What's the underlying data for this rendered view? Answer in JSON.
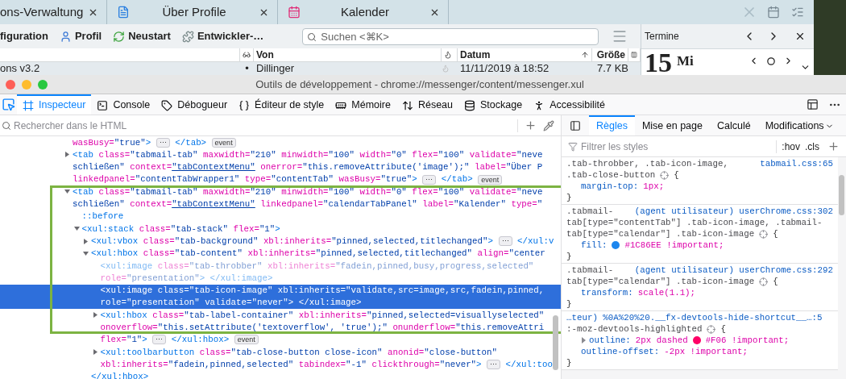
{
  "mail_app": {
    "tabs": [
      {
        "label": "ons-Verwaltung"
      },
      {
        "label": "Über Profile"
      },
      {
        "label": "Kalender"
      }
    ],
    "toolbar": [
      {
        "label": "figuration"
      },
      {
        "label": "Profil"
      },
      {
        "label": "Neustart"
      },
      {
        "label": "Entwickler-…"
      }
    ],
    "search": {
      "placeholder": "Suchen <⌘K>"
    },
    "columns": [
      {
        "kind": "text"
      },
      {
        "kind": "icon"
      },
      {
        "kind": "text",
        "label": "Von"
      },
      {
        "kind": "icon"
      },
      {
        "kind": "sort",
        "label": "Datum"
      },
      {
        "kind": "text",
        "label": "Größe"
      },
      {
        "kind": "icon"
      }
    ],
    "row": {
      "subject": "ons v3.2",
      "read_mark": "•",
      "from": "Dillinger",
      "date": "11/11/2019 à 18:52",
      "size": "7.7 KB"
    },
    "today_pane": {
      "title": "Termine",
      "day": "15",
      "weekday": "Mi"
    }
  },
  "devtools": {
    "title": "Outils de développement - chrome://messenger/content/messenger.xul",
    "tools": [
      {
        "label": "Inspecteur",
        "selected": true
      },
      {
        "label": "Console",
        "selected": false
      },
      {
        "label": "Débogueur",
        "selected": false
      },
      {
        "label": "Éditeur de style",
        "selected": false
      },
      {
        "label": "Mémoire",
        "selected": false
      },
      {
        "label": "Réseau",
        "selected": false
      },
      {
        "label": "Stockage",
        "selected": false
      },
      {
        "label": "Accessibilité",
        "selected": false
      }
    ],
    "html_search": {
      "placeholder": "Rechercher dans le HTML"
    },
    "markup": {
      "nodes": [
        {
          "kind": "leaf",
          "selected": false,
          "dimmed": false,
          "lines": [
            [
              {
                "kind": "attr",
                "name": "wasBusy=",
                "value": "\"true\"",
                "end": ">"
              },
              {
                "kind": "badge",
                "text": "⋯"
              },
              {
                "kind": "tag",
                "text": "</tab>"
              },
              {
                "kind": "badge",
                "text": "event"
              }
            ]
          ]
        },
        {
          "kind": "collapsed",
          "selected": false,
          "dimmed": false,
          "lines": [
            [
              {
                "kind": "tag",
                "text": "<tab"
              },
              {
                "kind": "attr",
                "name": "class=",
                "value": "\"tabmail-tab\""
              },
              {
                "kind": "attr",
                "name": "maxwidth=",
                "value": "\"210\""
              },
              {
                "kind": "attr",
                "name": "minwidth=",
                "value": "\"100\""
              },
              {
                "kind": "attr",
                "name": "width=",
                "value": "\"0\""
              },
              {
                "kind": "attr",
                "name": "flex=",
                "value": "\"100\""
              },
              {
                "kind": "attr",
                "name": "validate=",
                "value": "\"neve"
              }
            ],
            [
              {
                "kind": "attr",
                "value": "schließen\""
              },
              {
                "kind": "attr",
                "name": "context=",
                "value": "\"tabContextMenu\"",
                "link": true
              },
              {
                "kind": "attr",
                "name": "onerror=",
                "value": "\"this.removeAttribute('image');\""
              },
              {
                "kind": "attr",
                "name": "label=",
                "value": "\"Über P"
              }
            ],
            [
              {
                "kind": "attr",
                "name": "linkedpanel=",
                "value": "\"contentTabWrapper1\""
              },
              {
                "kind": "attr",
                "name": "type=",
                "value": "\"contentTab\""
              },
              {
                "kind": "attr",
                "name": "wasBusy=",
                "value": "\"true\"",
                "end": ">"
              },
              {
                "kind": "badge",
                "text": "⋯"
              },
              {
                "kind": "tag",
                "text": "</tab>"
              },
              {
                "kind": "badge",
                "text": "event"
              }
            ]
          ]
        },
        {
          "kind": "expanded",
          "selected": false,
          "dimmed": false,
          "lines": [
            [
              {
                "kind": "tag",
                "text": "<tab"
              },
              {
                "kind": "attr",
                "name": "class=",
                "value": "\"tabmail-tab\""
              },
              {
                "kind": "attr",
                "name": "maxwidth=",
                "value": "\"210\""
              },
              {
                "kind": "attr",
                "name": "minwidth=",
                "value": "\"100\""
              },
              {
                "kind": "attr",
                "name": "width=",
                "value": "\"0\""
              },
              {
                "kind": "attr",
                "name": "flex=",
                "value": "\"100\""
              },
              {
                "kind": "attr",
                "name": "validate=",
                "value": "\"neve"
              }
            ],
            [
              {
                "kind": "attr",
                "value": "schließen\""
              },
              {
                "kind": "attr",
                "name": "context=",
                "value": "\"tabContextMenu\"",
                "link": true
              },
              {
                "kind": "attr",
                "name": "linkedpanel=",
                "value": "\"calendarTabPanel\""
              },
              {
                "kind": "attr",
                "name": "label=",
                "value": "\"Kalender\""
              },
              {
                "kind": "attr",
                "name": "type=",
                "value": "\""
              }
            ]
          ],
          "children": [
            {
              "kind": "leaf",
              "selected": false,
              "dimmed": false,
              "lines": [
                [
                  {
                    "kind": "tag",
                    "text": "::before"
                  }
                ]
              ]
            },
            {
              "kind": "expanded",
              "selected": false,
              "dimmed": false,
              "lines": [
                [
                  {
                    "kind": "tag",
                    "text": "<xul:stack"
                  },
                  {
                    "kind": "attr",
                    "name": "class=",
                    "value": "\"tab-stack\""
                  },
                  {
                    "kind": "attr",
                    "name": "flex=",
                    "value": "\"1\"",
                    "end": ">"
                  }
                ]
              ],
              "children": [
                {
                  "kind": "collapsed",
                  "selected": false,
                  "dimmed": false,
                  "lines": [
                    [
                      {
                        "kind": "tag",
                        "text": "<xul:vbox"
                      },
                      {
                        "kind": "attr",
                        "name": "class=",
                        "value": "\"tab-background\""
                      },
                      {
                        "kind": "attr",
                        "name": "xbl:inherits=",
                        "value": "\"pinned,selected,titlechanged\"",
                        "end": ">"
                      },
                      {
                        "kind": "badge",
                        "text": "⋯"
                      },
                      {
                        "kind": "tag",
                        "text": "</xul:v"
                      }
                    ]
                  ]
                },
                {
                  "kind": "expanded",
                  "selected": false,
                  "dimmed": false,
                  "lines": [
                    [
                      {
                        "kind": "tag",
                        "text": "<xul:hbox"
                      },
                      {
                        "kind": "attr",
                        "name": "class=",
                        "value": "\"tab-content\""
                      },
                      {
                        "kind": "attr",
                        "name": "xbl:inherits=",
                        "value": "\"pinned,selected,titlechanged\""
                      },
                      {
                        "kind": "attr",
                        "name": "align=",
                        "value": "\"center"
                      }
                    ]
                  ],
                  "children": [
                    {
                      "kind": "leaf",
                      "selected": false,
                      "dimmed": true,
                      "lines": [
                        [
                          {
                            "kind": "tag",
                            "text": "<xul:image"
                          },
                          {
                            "kind": "attr",
                            "name": "class=",
                            "value": "\"tab-throbber\""
                          },
                          {
                            "kind": "attr",
                            "name": "xbl:inherits=",
                            "value": "\"fadein,pinned,busy,progress,selected\""
                          }
                        ],
                        [
                          {
                            "kind": "attr",
                            "name": "role=",
                            "value": "\"presentation\"",
                            "end": ">"
                          },
                          {
                            "kind": "tag",
                            "text": "</xul:image>"
                          }
                        ]
                      ]
                    },
                    {
                      "kind": "leaf",
                      "selected": true,
                      "dimmed": false,
                      "lines": [
                        [
                          {
                            "kind": "tag",
                            "text": "<xul:image"
                          },
                          {
                            "kind": "attr",
                            "name": "class=",
                            "value": "\"tab-icon-image\""
                          },
                          {
                            "kind": "attr",
                            "name": "xbl:inherits=",
                            "value": "\"validate,src=image,src,fadein,pinned,"
                          }
                        ],
                        [
                          {
                            "kind": "attr",
                            "name": "role=",
                            "value": "\"presentation\""
                          },
                          {
                            "kind": "attr",
                            "name": "validate=",
                            "value": "\"never\"",
                            "end": ">"
                          },
                          {
                            "kind": "tag",
                            "text": "</xul:image>"
                          }
                        ]
                      ]
                    },
                    {
                      "kind": "collapsed",
                      "selected": false,
                      "dimmed": false,
                      "lines": [
                        [
                          {
                            "kind": "tag",
                            "text": "<xul:hbox"
                          },
                          {
                            "kind": "attr",
                            "name": "class=",
                            "value": "\"tab-label-container\""
                          },
                          {
                            "kind": "attr",
                            "name": "xbl:inherits=",
                            "value": "\"pinned,selected=visuallyselected\""
                          }
                        ],
                        [
                          {
                            "kind": "attr",
                            "name": "onoverflow=",
                            "value": "\"this.setAttribute('textoverflow', 'true');\""
                          },
                          {
                            "kind": "attr",
                            "name": "onunderflow=",
                            "value": "\"this.removeAttri"
                          }
                        ],
                        [
                          {
                            "kind": "attr",
                            "name": "flex=",
                            "value": "\"1\"",
                            "end": ">"
                          },
                          {
                            "kind": "badge",
                            "text": "⋯"
                          },
                          {
                            "kind": "tag",
                            "text": "</xul:hbox>"
                          },
                          {
                            "kind": "badge",
                            "text": "event"
                          }
                        ]
                      ]
                    },
                    {
                      "kind": "collapsed",
                      "selected": false,
                      "dimmed": false,
                      "lines": [
                        [
                          {
                            "kind": "tag",
                            "text": "<xul:toolbarbutton"
                          },
                          {
                            "kind": "attr",
                            "name": "class=",
                            "value": "\"tab-close-button close-icon\""
                          },
                          {
                            "kind": "attr",
                            "name": "anonid=",
                            "value": "\"close-button\""
                          }
                        ],
                        [
                          {
                            "kind": "attr",
                            "name": "xbl:inherits=",
                            "value": "\"fadein,pinned,selected\""
                          },
                          {
                            "kind": "attr",
                            "name": "tabindex=",
                            "value": "\"-1\""
                          },
                          {
                            "kind": "attr",
                            "name": "clickthrough=",
                            "value": "\"never\"",
                            "end": ">"
                          },
                          {
                            "kind": "badge",
                            "text": "⋯"
                          },
                          {
                            "kind": "tag",
                            "text": "</xul:too"
                          }
                        ]
                      ]
                    }
                  ],
                  "close": [
                    {
                      "kind": "tag",
                      "text": "</xul:hbox>"
                    }
                  ]
                }
              ]
            }
          ]
        }
      ]
    },
    "sidebar_tabs": [
      {
        "label": "Règles",
        "selected": true
      },
      {
        "label": "Mise en page",
        "selected": false
      },
      {
        "label": "Calculé",
        "selected": false
      },
      {
        "label": "Modifications",
        "selected": false
      }
    ],
    "rules_filter": {
      "placeholder": "Filtrer les styles",
      "buttons": [
        ":hov",
        ".cls"
      ]
    },
    "rules": [
      {
        "source": "tabmail.css:65",
        "source_own_line": false,
        "selector_lines": [
          ".tab-throbber, .tab-icon-image,",
          ".tab-close-button"
        ],
        "open": "{",
        "close": "}",
        "declarations": [
          {
            "property": "margin-top:",
            "expandable": false,
            "value": [
              "1px;"
            ]
          }
        ]
      },
      {
        "source": "(agent utilisateur) userChrome.css:302",
        "source_own_line": false,
        "selector_lines": [
          ".tabmail-",
          "tab[type=\"contentTab\"] .tab-icon-image, .tabmail-",
          "tab[type=\"calendar\"] .tab-icon-image"
        ],
        "open": "{",
        "close": "}",
        "declarations": [
          {
            "property": "fill:",
            "expandable": false,
            "color": "#1C86EE",
            "value": [
              "#1C86EE !important;"
            ]
          }
        ]
      },
      {
        "source": "(agent utilisateur) userChrome.css:292",
        "source_own_line": false,
        "selector_lines": [
          ".tabmail-",
          "tab[type=\"calendar\"] .tab-icon-image"
        ],
        "open": "{",
        "close": "}",
        "declarations": [
          {
            "property": "transform:",
            "expandable": false,
            "value": [
              "scale(1.1);"
            ]
          }
        ]
      },
      {
        "source": "…teur) %0A%20%20.__fx-devtools-hide-shortcut__…:5",
        "source_own_line": true,
        "selector_lines": [
          ":-moz-devtools-highlighted"
        ],
        "open": "{",
        "close": "}",
        "declarations": [
          {
            "property": "outline:",
            "expandable": true,
            "color": "#FF0066",
            "value": [
              "2px dashed",
              "#F06 !important;"
            ]
          },
          {
            "property": "outline-offset:",
            "expandable": false,
            "value": [
              "-2px !important;"
            ]
          }
        ]
      }
    ]
  }
}
